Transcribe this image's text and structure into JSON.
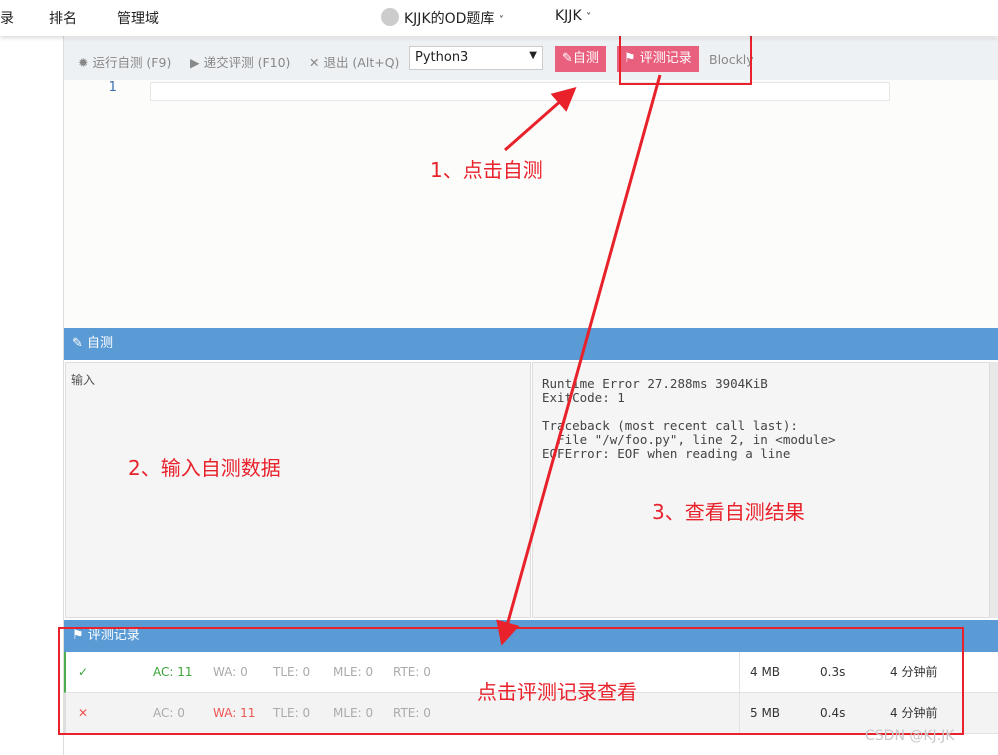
{
  "nav": {
    "items": [
      "录",
      "排名",
      "管理域"
    ],
    "site": "KJJK的OD题库",
    "user": "KJJK"
  },
  "toolbar": {
    "run": "运行自测 (F9)",
    "submit": "递交评测 (F10)",
    "exit": "退出 (Alt+Q)",
    "language": "Python3",
    "selftest": "自测",
    "records": "评测记录",
    "blockly": "Blockly"
  },
  "editor": {
    "line_number": "1"
  },
  "selftest": {
    "title": "自测",
    "input_label": "输入",
    "output": "Runtime Error 27.288ms 3904KiB\nExitCode: 1\n\nTraceback (most recent call last):\n  File \"/w/foo.py\", line 2, in <module>\nEOFError: EOF when reading a line"
  },
  "records": {
    "title": "评测记录",
    "rows": [
      {
        "status": "✓",
        "ac": "AC: 11",
        "wa": "WA: 0",
        "tle": "TLE: 0",
        "mle": "MLE: 0",
        "rte": "RTE: 0",
        "mem": "4 MB",
        "time": "0.3s",
        "when": "4 分钟前"
      },
      {
        "status": "✕",
        "ac": "AC: 0",
        "wa": "WA: 11",
        "tle": "TLE: 0",
        "mle": "MLE: 0",
        "rte": "RTE: 0",
        "mem": "5 MB",
        "time": "0.4s",
        "when": "4 分钟前"
      }
    ]
  },
  "annotations": {
    "a1": "1、点击自测",
    "a2": "2、输入自测数据",
    "a3": "3、查看自测结果",
    "a4": "点击评测记录查看"
  },
  "watermark": "CSDN @KJ.JK"
}
